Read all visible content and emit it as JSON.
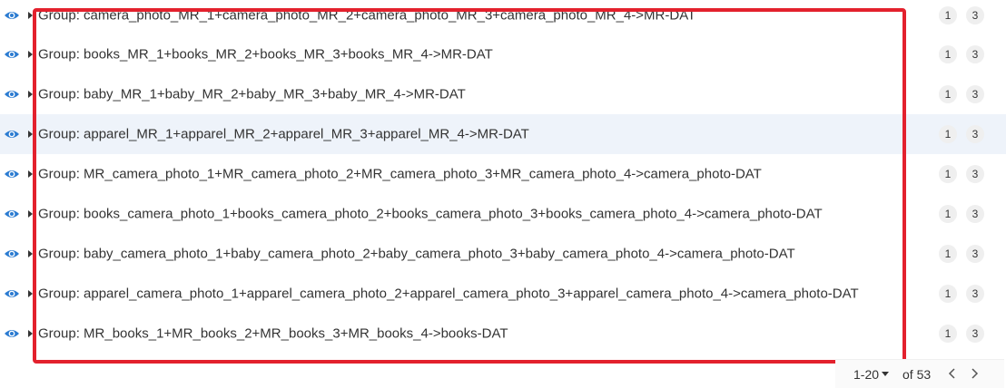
{
  "rows": [
    {
      "label": "Group: camera_photo_MR_1+camera_photo_MR_2+camera_photo_MR_3+camera_photo_MR_4->MR-DAT",
      "badge1": "1",
      "badge2": "3"
    },
    {
      "label": "Group: books_MR_1+books_MR_2+books_MR_3+books_MR_4->MR-DAT",
      "badge1": "1",
      "badge2": "3"
    },
    {
      "label": "Group: baby_MR_1+baby_MR_2+baby_MR_3+baby_MR_4->MR-DAT",
      "badge1": "1",
      "badge2": "3"
    },
    {
      "label": "Group: apparel_MR_1+apparel_MR_2+apparel_MR_3+apparel_MR_4->MR-DAT",
      "badge1": "1",
      "badge2": "3"
    },
    {
      "label": "Group: MR_camera_photo_1+MR_camera_photo_2+MR_camera_photo_3+MR_camera_photo_4->camera_photo-DAT",
      "badge1": "1",
      "badge2": "3"
    },
    {
      "label": "Group: books_camera_photo_1+books_camera_photo_2+books_camera_photo_3+books_camera_photo_4->camera_photo-DAT",
      "badge1": "1",
      "badge2": "3"
    },
    {
      "label": "Group: baby_camera_photo_1+baby_camera_photo_2+baby_camera_photo_3+baby_camera_photo_4->camera_photo-DAT",
      "badge1": "1",
      "badge2": "3"
    },
    {
      "label": "Group: apparel_camera_photo_1+apparel_camera_photo_2+apparel_camera_photo_3+apparel_camera_photo_4->camera_photo-DAT",
      "badge1": "1",
      "badge2": "3"
    },
    {
      "label": "Group: MR_books_1+MR_books_2+MR_books_3+MR_books_4->books-DAT",
      "badge1": "1",
      "badge2": "3"
    }
  ],
  "pagination": {
    "range": "1-20",
    "total": "of 53"
  },
  "icons": {
    "row_visibility": "eye-icon",
    "row_expand": "caret-right-icon",
    "prev": "chevron-left-icon",
    "next": "chevron-right-icon"
  },
  "colors": {
    "eye": "#2b7bd1",
    "highlight_border": "#e3212d",
    "selected_row": "#eef3fa",
    "badge_bg": "#efefef"
  },
  "selected_row_index": 3
}
